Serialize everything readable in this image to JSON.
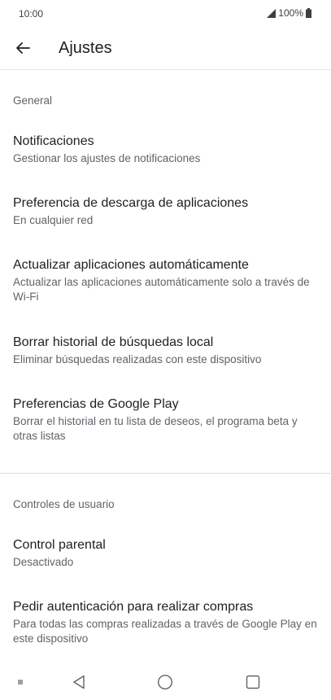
{
  "status_bar": {
    "time": "10:00",
    "battery": "100%"
  },
  "app_bar": {
    "title": "Ajustes"
  },
  "sections": {
    "general": {
      "header": "General",
      "items": [
        {
          "title": "Notificaciones",
          "subtitle": "Gestionar los ajustes de notificaciones"
        },
        {
          "title": "Preferencia de descarga de aplicaciones",
          "subtitle": "En cualquier red"
        },
        {
          "title": "Actualizar aplicaciones automáticamente",
          "subtitle": "Actualizar las aplicaciones automáticamente solo a través de Wi-Fi"
        },
        {
          "title": "Borrar historial de búsquedas local",
          "subtitle": "Eliminar búsquedas realizadas con este dispositivo"
        },
        {
          "title": "Preferencias de Google Play",
          "subtitle": "Borrar el historial en tu lista de deseos, el programa beta y otras listas"
        }
      ]
    },
    "user_controls": {
      "header": "Controles de usuario",
      "items": [
        {
          "title": "Control parental",
          "subtitle": "Desactivado"
        },
        {
          "title": "Pedir autenticación para realizar compras",
          "subtitle": "Para todas las compras realizadas a través de Google Play en este dispositivo"
        }
      ]
    }
  },
  "colors": {
    "text_primary": "#202124",
    "text_secondary": "#5f6368",
    "divider": "#e0e0e0"
  }
}
